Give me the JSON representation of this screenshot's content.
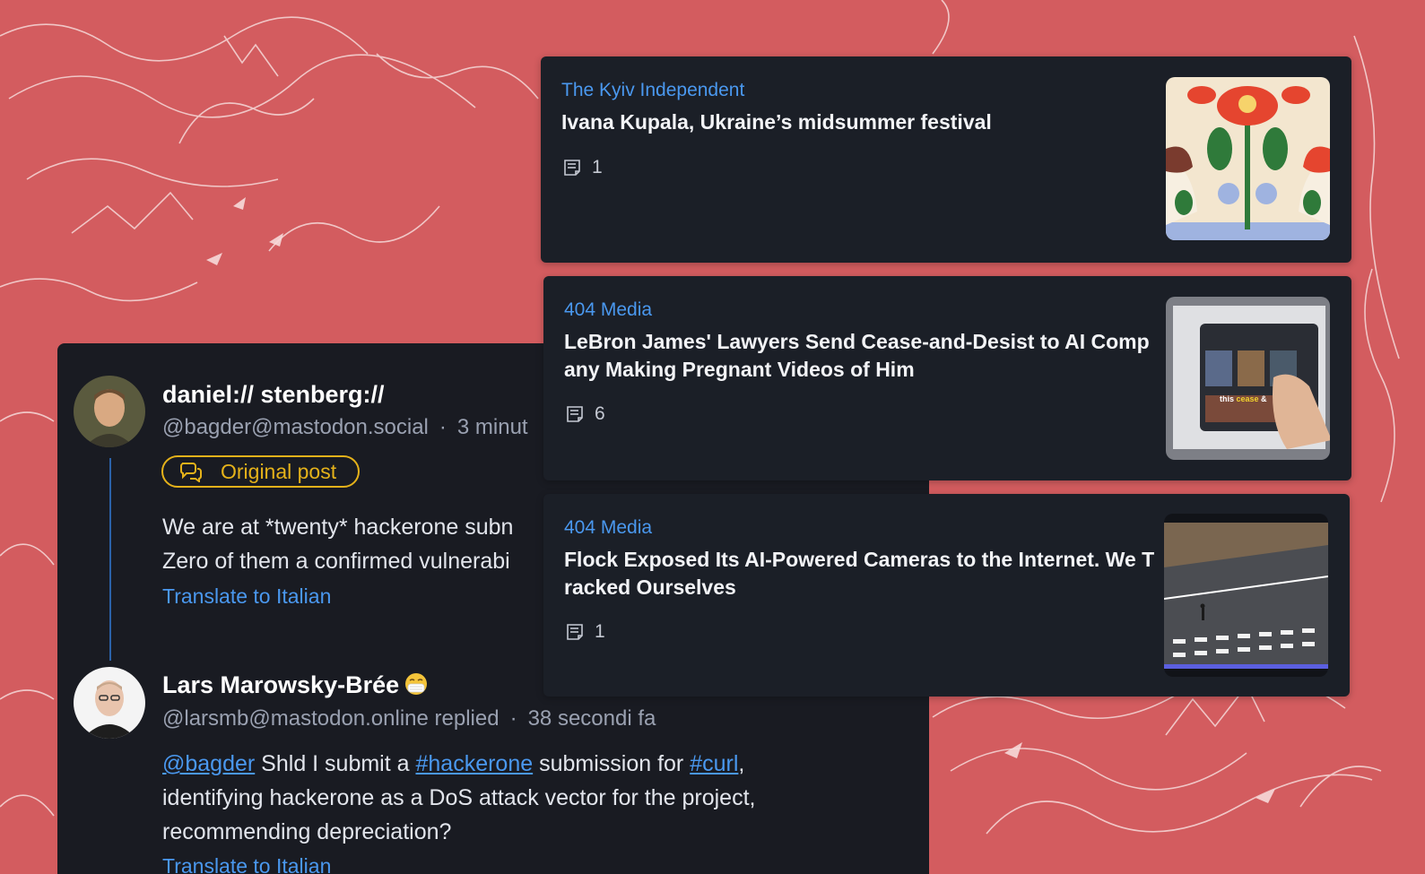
{
  "colors": {
    "background": "#d35c5f",
    "panel": "#191b22",
    "card": "#1b1f27",
    "link": "#4a98ef",
    "badge": "#e5b21a"
  },
  "thread": {
    "post": {
      "display_name": "daniel:// stenberg://",
      "handle": "@bagder@mastodon.social",
      "time": "3 minut",
      "badge_label": "Original post",
      "badge_icon": "chat-bubbles-icon",
      "text_line1": "We are at *twenty* hackerone subn",
      "text_line2": "Zero of them a confirmed vulnerabi",
      "translate_label": "Translate to Italian"
    },
    "reply": {
      "display_name": "Lars Marowsky-Brée",
      "emoji": "mask-emoji-icon",
      "handle": "@larsmb@mastodon.online replied",
      "time": "38 secondi fa",
      "mention": "@bagder",
      "text_a": " Shld I submit a ",
      "tag1": "#hackerone",
      "text_b": " submission for ",
      "tag2": "#curl",
      "text_c": ",",
      "line2": "identifying hackerone as a DoS attack vector for the project,",
      "line3": "recommending depreciation?",
      "translate_label": "Translate to Italian"
    }
  },
  "news": [
    {
      "source": "The Kyiv Independent",
      "title": "Ivana Kupala, Ukraine’s midsummer festival",
      "comments": "1"
    },
    {
      "source": "404 Media",
      "title": "LeBron James' Lawyers Send Cease-and-Desist to AI Company Making Pregnant Videos of Him",
      "comments": "6",
      "thumb_caption_a": "this ",
      "thumb_caption_b": "cease",
      "thumb_caption_c": " &"
    },
    {
      "source": "404 Media",
      "title": "Flock Exposed Its AI-Powered Cameras to the Internet. We Tracked Ourselves",
      "comments": "1"
    }
  ]
}
